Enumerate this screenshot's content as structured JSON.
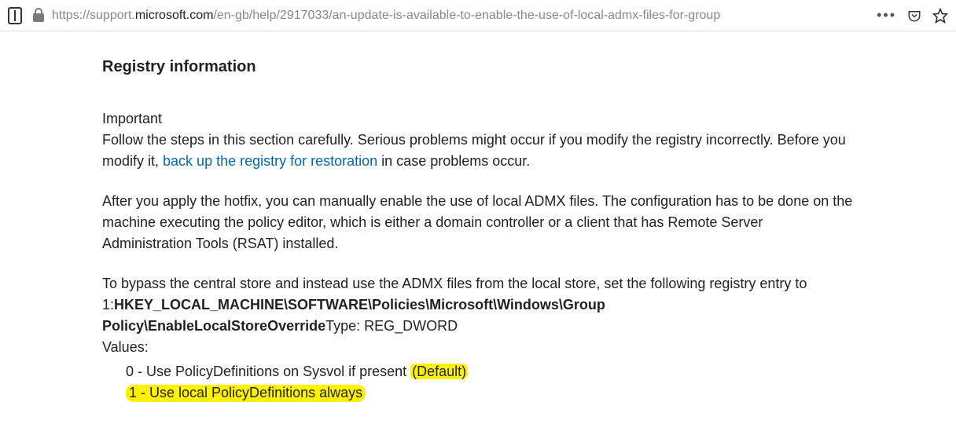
{
  "addressbar": {
    "url_prefix": "https://support.",
    "url_domain": "microsoft.com",
    "url_path": "/en-gb/help/2917033/an-update-is-available-to-enable-the-use-of-local-admx-files-for-group"
  },
  "article": {
    "heading": "Registry information",
    "important_label": "Important",
    "warning_before_link": "Follow the steps in this section carefully. Serious problems might occur if you modify the registry incorrectly. Before you modify it, ",
    "backup_link_text": "back up the registry for restoration",
    "warning_after_link": " in case problems occur.",
    "para2": "After you apply the hotfix, you can manually enable the use of local ADMX files. The configuration has to be done on the machine executing the policy editor, which is either a domain controller or a client that has Remote Server Administration Tools (RSAT) installed.",
    "para3_lead": "To bypass the central store and instead use the ADMX files from the local store, set the following registry entry to 1:",
    "registry_path": "HKEY_LOCAL_MACHINE\\SOFTWARE\\Policies\\Microsoft\\Windows\\Group Policy\\EnableLocalStoreOverride",
    "type_line": "Type: REG_DWORD",
    "values_label": "Values:",
    "value0_text": "0 - Use PolicyDefinitions on Sysvol if present ",
    "value0_default": "(Default)",
    "value1_text": "1 - Use local PolicyDefinitions always"
  }
}
